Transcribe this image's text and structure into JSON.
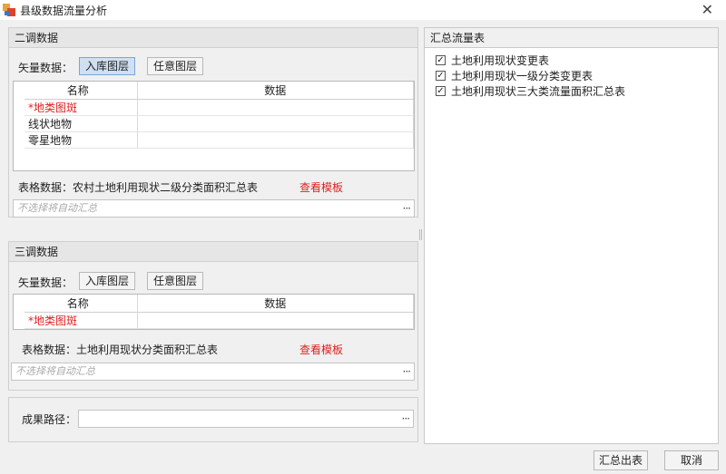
{
  "window": {
    "title": "县级数据流量分析",
    "close_glyph": "✕"
  },
  "erdiao": {
    "header": "二调数据",
    "vector_label": "矢量数据：",
    "btn_db_layer": "入库图层",
    "btn_any_layer": "任意图层",
    "grid": {
      "col_name": "名称",
      "col_data": "数据",
      "rows": [
        {
          "required": true,
          "label": "地类图斑",
          "data": ""
        },
        {
          "required": false,
          "label": "线状地物",
          "data": ""
        },
        {
          "required": false,
          "label": "零星地物",
          "data": ""
        }
      ]
    },
    "table_label": "表格数据：农村土地利用现状二级分类面积汇总表",
    "view_template": "查看模板",
    "placeholder": "不选择将自动汇总"
  },
  "sandiao": {
    "header": "三调数据",
    "vector_label": "矢量数据：",
    "btn_db_layer": "入库图层",
    "btn_any_layer": "任意图层",
    "grid": {
      "col_name": "名称",
      "col_data": "数据",
      "rows": [
        {
          "required": true,
          "label": "地类图斑",
          "data": ""
        }
      ]
    },
    "table_label": "表格数据：土地利用现状分类面积汇总表",
    "view_template": "查看模板",
    "placeholder": "不选择将自动汇总"
  },
  "output": {
    "label": "成果路径：",
    "value": ""
  },
  "summary": {
    "header": "汇总流量表",
    "items": [
      {
        "checked": true,
        "label": "土地利用现状变更表"
      },
      {
        "checked": true,
        "label": "土地利用现状一级分类变更表"
      },
      {
        "checked": true,
        "label": "土地利用现状三大类流量面积汇总表"
      }
    ]
  },
  "footer": {
    "export": "汇总出表",
    "cancel": "取消"
  },
  "required_mark": "*",
  "ellipsis": "···",
  "check_glyph": "✓",
  "colors": {
    "required": "#e02020",
    "active_button": "#cfe0f3"
  }
}
